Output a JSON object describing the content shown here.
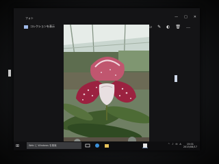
{
  "window": {
    "title": "フォト",
    "controls": [
      "—",
      "□",
      "✕"
    ]
  },
  "command_bar": {
    "breadcrumb": "コレクションを表示",
    "actions": [
      {
        "name": "share-icon",
        "glyph": "⇪"
      },
      {
        "name": "slideshow-icon",
        "glyph": "▭"
      },
      {
        "name": "edit-icon",
        "glyph": "✎"
      },
      {
        "name": "enhance-icon",
        "glyph": "◐"
      },
      {
        "name": "delete-icon",
        "glyph": "🗑"
      },
      {
        "name": "more-icon",
        "glyph": "…"
      }
    ]
  },
  "taskbar": {
    "start_glyph": "⊞",
    "search_placeholder": "Web と Windows を検索",
    "clock_time": "15:01",
    "clock_date": "2015/08/17",
    "tray_glyphs": [
      "^",
      "♪",
      "✉",
      "A"
    ]
  },
  "colors": {
    "accent": "#4a90e2",
    "petal": "#b23a55",
    "leaf": "#3f5a2c"
  }
}
